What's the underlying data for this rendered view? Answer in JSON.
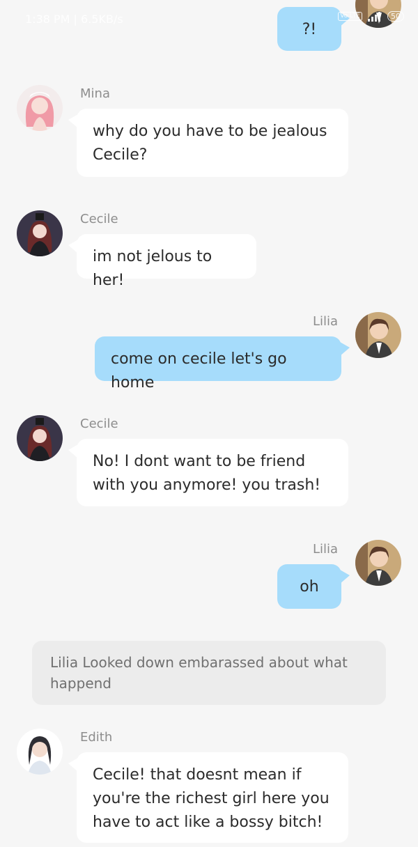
{
  "status_bar": {
    "time": "1:38 PM | 6.5KB/s",
    "volte": "Vo LTE",
    "battery": "50"
  },
  "messages": [
    {
      "side": "right",
      "sender": "",
      "text": "?!",
      "avatar_icon": "lilia-avatar"
    },
    {
      "side": "left",
      "sender": "Mina",
      "text": "why do you have to be jealous Cecile?",
      "avatar_icon": "mina-avatar"
    },
    {
      "side": "left",
      "sender": "Cecile",
      "text": "im not jelous to her!",
      "avatar_icon": "cecile-avatar"
    },
    {
      "side": "right",
      "sender": "Lilia",
      "text": "come on cecile let's go home",
      "avatar_icon": "lilia-avatar"
    },
    {
      "side": "left",
      "sender": "Cecile",
      "text": "No! I dont want to be friend with you anymore! you trash!",
      "avatar_icon": "cecile-avatar"
    },
    {
      "side": "right",
      "sender": "Lilia",
      "text": "oh",
      "avatar_icon": "lilia-avatar"
    },
    {
      "side": "left",
      "sender": "Edith",
      "text": "Cecile! that doesnt mean if you're the richest girl here you have to act like a bossy bitch!",
      "avatar_icon": "edith-avatar"
    }
  ],
  "narration": "Lilia Looked down embarassed about what happend",
  "colors": {
    "background": "#f6f6f6",
    "left_bubble": "#ffffff",
    "right_bubble": "#a6dcfb",
    "narration_bg": "#ececec",
    "name_text": "#8d8d8d"
  }
}
